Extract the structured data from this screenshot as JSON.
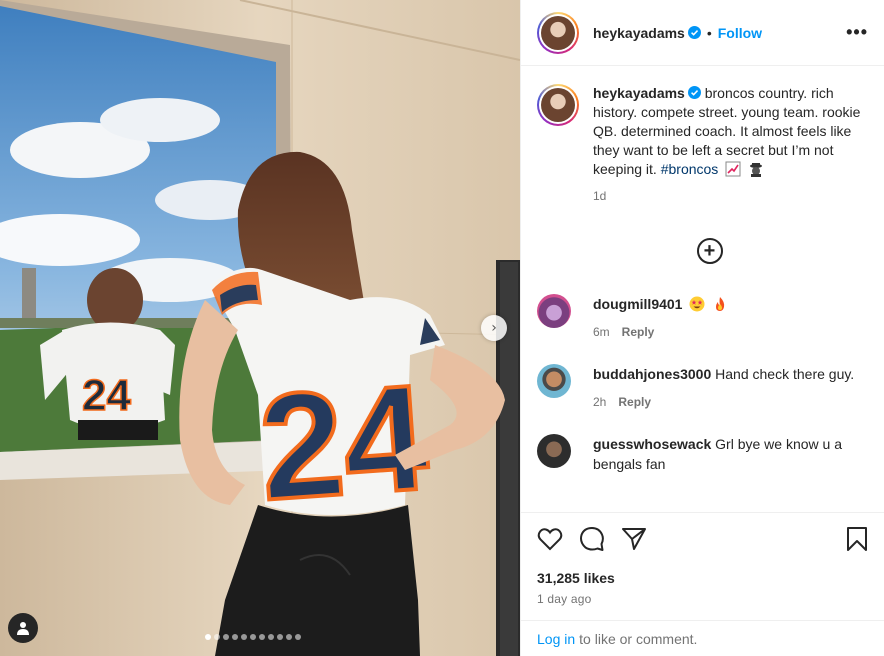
{
  "post": {
    "username": "heykayadams",
    "follow_label": "Follow",
    "separator": "•",
    "more_label": "•••",
    "caption": "broncos country. rich history. compete street. young team. rookie QB. determined coach. It almost feels like they want to be left a secret but I’m not keeping it.",
    "hashtag": "#broncos",
    "caption_time": "1d",
    "jersey_number": "24"
  },
  "comments": [
    {
      "username": "dougmill9401",
      "text": "",
      "emojis": [
        "star-struck-emoji",
        "fire-emoji"
      ],
      "time": "6m",
      "reply_label": "Reply"
    },
    {
      "username": "buddahjones3000",
      "text": "Hand check there guy.",
      "time": "2h",
      "reply_label": "Reply"
    },
    {
      "username": "guesswhosewack",
      "text": "Grl bye we know u a bengals fan",
      "time": "",
      "reply_label": ""
    }
  ],
  "engagement": {
    "likes": "31,285 likes",
    "posted_ago": "1 day ago"
  },
  "login": {
    "link": "Log in",
    "rest": "to like or comment."
  },
  "carousel": {
    "total": 11,
    "active": 0
  },
  "colors": {
    "accent": "#0095f6",
    "hashtag": "#00376b",
    "muted": "#737373"
  }
}
